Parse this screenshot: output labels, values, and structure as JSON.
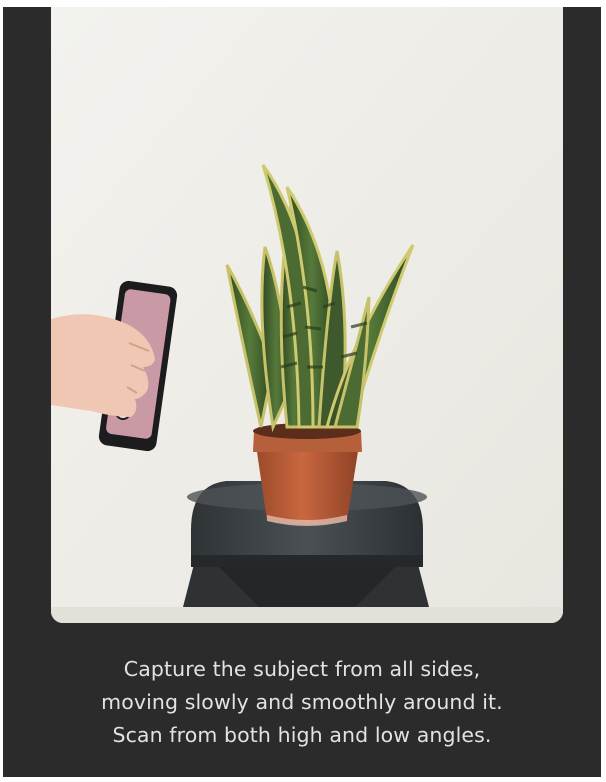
{
  "screen": {
    "name": "object-capture-instructions",
    "background_color": "#2b2b2b"
  },
  "photo": {
    "subject": "potted snake plant on dark metal stool, hand holding phone",
    "icons": [
      "snake-plant",
      "flower-pot",
      "metal-stool",
      "hand",
      "smartphone"
    ]
  },
  "instructions": {
    "line1": "Capture the subject from all sides,",
    "line2": "moving slowly and smoothly around it.",
    "line3": "Scan from both high and low angles."
  },
  "colors": {
    "text": "#e2e2e2",
    "wall": "#eeece6",
    "pot": "#b25a36",
    "stool": "#3f4448",
    "leaf_dark": "#3e5a2c",
    "leaf_edge": "#c9c46a"
  }
}
